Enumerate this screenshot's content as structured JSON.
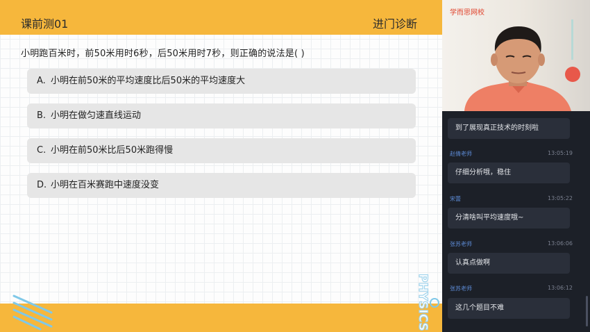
{
  "slide": {
    "title": "课前测01",
    "tag": "进门诊断",
    "question": "小明跑百米时，前50米用时6秒，后50米用时7秒，则正确的说法是(      )",
    "options": [
      {
        "letter": "A.",
        "text": "小明在前50米的平均速度比后50米的平均速度大"
      },
      {
        "letter": "B.",
        "text": "小明在做匀速直线运动"
      },
      {
        "letter": "C.",
        "text": "小明在前50米比后50米跑得慢"
      },
      {
        "letter": "D.",
        "text": "小明在百米赛跑中速度没变"
      }
    ],
    "watermark": "PHYSICS",
    "colors": {
      "accent": "#f6b73c",
      "option_bg": "#e6e6e6"
    }
  },
  "video": {
    "brand": "学而思网校"
  },
  "chat": {
    "messages": [
      {
        "sender": "",
        "time": "",
        "text": "到了展现真正技术的时刻啦"
      },
      {
        "sender": "赵倩老师",
        "time": "13:05:19",
        "text": "仔细分析哦，稳住"
      },
      {
        "sender": "宋蕾",
        "time": "13:05:22",
        "text": "分清啥叫平均速度哦~"
      },
      {
        "sender": "张苏老师",
        "time": "13:06:06",
        "text": "认真点做啊"
      },
      {
        "sender": "张苏老师",
        "time": "13:06:12",
        "text": "这几个题目不难"
      }
    ],
    "colors": {
      "bg": "#1c2028",
      "bubble": "#2a2f3a",
      "sender": "#5d8bd6"
    }
  }
}
